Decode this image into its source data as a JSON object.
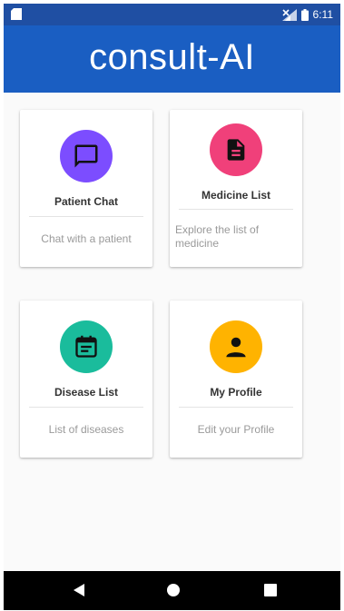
{
  "status_bar": {
    "time": "6:11"
  },
  "app_bar": {
    "title": "consult-AI"
  },
  "cards": [
    {
      "title": "Patient Chat",
      "subtitle": "Chat with a patient",
      "icon": "chat-bubble-icon",
      "color": "#7c4dff"
    },
    {
      "title": "Medicine List",
      "subtitle": "Explore the list of medicine",
      "icon": "document-icon",
      "color": "#f0407a"
    },
    {
      "title": "Disease List",
      "subtitle": "List of diseases",
      "icon": "calendar-list-icon",
      "color": "#1abc9c"
    },
    {
      "title": "My Profile",
      "subtitle": "Edit your Profile",
      "icon": "person-icon",
      "color": "#ffb300"
    }
  ],
  "nav_bar": {
    "back": "back-icon",
    "home": "home-icon",
    "recents": "recents-icon"
  }
}
